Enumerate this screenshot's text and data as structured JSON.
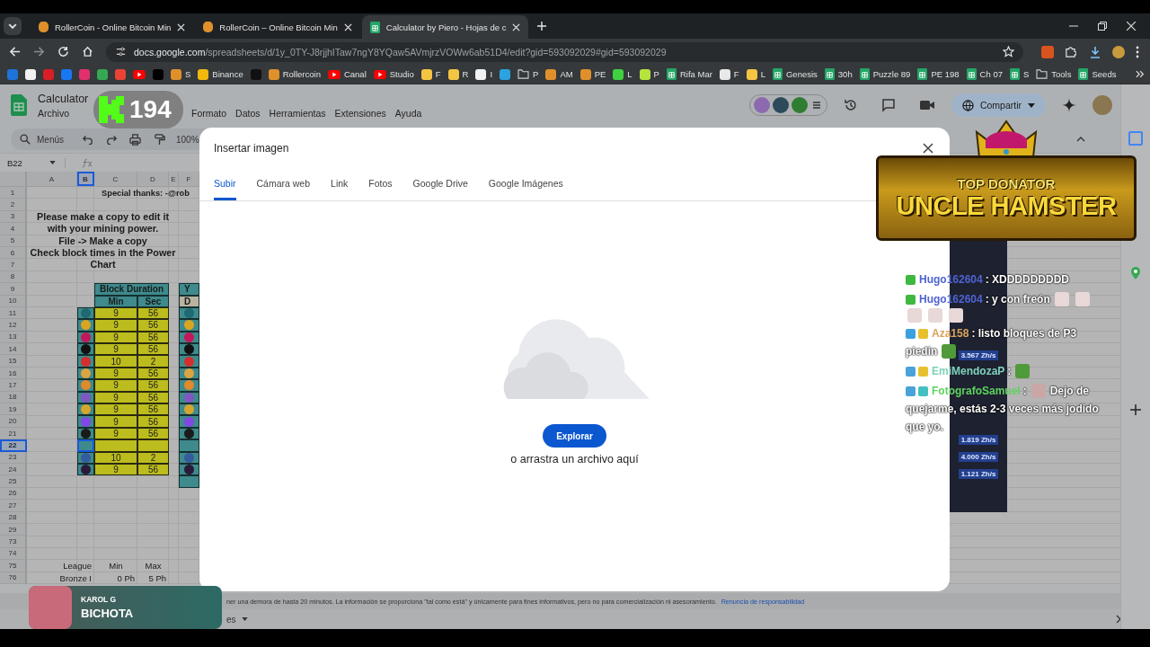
{
  "browser": {
    "tabs": [
      {
        "title": "RollerCoin - Online Bitcoin Min",
        "kind": "site",
        "selected": false
      },
      {
        "title": "RollerCoin – Online Bitcoin Min",
        "kind": "site",
        "selected": false
      },
      {
        "title": "Calculator by Piero - Hojas de c",
        "kind": "sheet",
        "selected": true
      }
    ],
    "url_host": "docs.google.com",
    "url_path": "/spreadsheets/d/1y_0TY-J8rjjhITaw7ngY8YQaw5AVmjrzVOWw6ab51D4/edit?gid=593092029#gid=593092029",
    "bookmarks": [
      {
        "kind": "site",
        "color": "#1e73d8"
      },
      {
        "kind": "site",
        "color": "#f2f2f2"
      },
      {
        "kind": "site",
        "color": "#d81f26"
      },
      {
        "kind": "site",
        "color": "#1877f2"
      },
      {
        "kind": "site",
        "color": "#e1306c"
      },
      {
        "kind": "site",
        "color": "#34a853"
      },
      {
        "kind": "site",
        "color": "#ea4335"
      },
      {
        "kind": "video"
      },
      {
        "kind": "site",
        "color": "#000000"
      },
      {
        "kind": "site",
        "color": "#e0902b",
        "label": "S"
      },
      {
        "kind": "site",
        "color": "#f0b90b",
        "label": "Binance"
      },
      {
        "kind": "site",
        "color": "#111111"
      },
      {
        "kind": "site",
        "color": "#e0902b",
        "label": "Rollercoin"
      },
      {
        "kind": "video",
        "label": "Canal"
      },
      {
        "kind": "video",
        "label": "Studio"
      },
      {
        "kind": "site",
        "color": "#f4c542",
        "label": "F"
      },
      {
        "kind": "site",
        "color": "#f4c542",
        "label": "R"
      },
      {
        "kind": "site",
        "color": "#f2f2f2",
        "label": "I"
      },
      {
        "kind": "site",
        "color": "#2aa3e0"
      },
      {
        "kind": "folder",
        "label": "P"
      },
      {
        "kind": "site",
        "color": "#e0902b",
        "label": "AM"
      },
      {
        "kind": "site",
        "color": "#e0902b",
        "label": "PE"
      },
      {
        "kind": "site",
        "color": "#3fd13f",
        "label": "L"
      },
      {
        "kind": "site",
        "color": "#b7e33d",
        "label": "P"
      },
      {
        "kind": "sheet",
        "label": "Rifa Mar"
      },
      {
        "kind": "site",
        "color": "#e8e8e8",
        "label": "F"
      },
      {
        "kind": "site",
        "color": "#f4c542",
        "label": "L"
      },
      {
        "kind": "sheet",
        "label": "Genesis"
      },
      {
        "kind": "sheet",
        "label": "30h"
      },
      {
        "kind": "sheet",
        "label": "Puzzle 89"
      },
      {
        "kind": "sheet",
        "label": "PE 198"
      },
      {
        "kind": "sheet",
        "label": "Ch 07"
      },
      {
        "kind": "sheet",
        "label": "S"
      },
      {
        "kind": "folder",
        "label": "Tools"
      },
      {
        "kind": "sheet",
        "label": "Seeds"
      }
    ]
  },
  "sheet": {
    "title": "Calculator",
    "menus": [
      "Archivo",
      "Formato",
      "Datos",
      "Herramientas",
      "Extensiones",
      "Ayuda"
    ],
    "search": {
      "placeholder": "Menús"
    },
    "zoom": "100%",
    "share": "Compartir",
    "name_box": "B22",
    "columns": [
      {
        "label": "A",
        "selected": false
      },
      {
        "label": "B",
        "selected": true
      },
      {
        "label": "C",
        "selected": false
      },
      {
        "label": "D",
        "selected": false
      },
      {
        "label": "E",
        "selected": false
      },
      {
        "label": "F",
        "selected": false
      }
    ],
    "rows": [
      {
        "label": "1",
        "selected": false
      },
      {
        "label": "2",
        "selected": false
      },
      {
        "label": "3",
        "selected": false
      },
      {
        "label": "4",
        "selected": false
      },
      {
        "label": "5",
        "selected": false
      },
      {
        "label": "6",
        "selected": false
      },
      {
        "label": "7",
        "selected": false
      },
      {
        "label": "8",
        "selected": false
      },
      {
        "label": "9",
        "selected": false
      },
      {
        "label": "10",
        "selected": false
      },
      {
        "label": "11",
        "selected": false
      },
      {
        "label": "12",
        "selected": false
      },
      {
        "label": "13",
        "selected": false
      },
      {
        "label": "14",
        "selected": false
      },
      {
        "label": "15",
        "selected": false
      },
      {
        "label": "16",
        "selected": false
      },
      {
        "label": "17",
        "selected": false
      },
      {
        "label": "18",
        "selected": false
      },
      {
        "label": "19",
        "selected": false
      },
      {
        "label": "20",
        "selected": false
      },
      {
        "label": "21",
        "selected": false
      },
      {
        "label": "22",
        "selected": true
      },
      {
        "label": "23",
        "selected": false
      },
      {
        "label": "24",
        "selected": false
      },
      {
        "label": "25",
        "selected": false
      },
      {
        "label": "26",
        "selected": false
      },
      {
        "label": "27",
        "selected": false
      },
      {
        "label": "28",
        "selected": false
      },
      {
        "label": "29",
        "selected": false
      },
      {
        "label": "73",
        "selected": false
      },
      {
        "label": "74",
        "selected": false
      },
      {
        "label": "75",
        "selected": false
      },
      {
        "label": "76",
        "selected": false
      }
    ],
    "note": "Special thanks:  -@rob",
    "instructions": [
      "Please make a copy to edit it",
      "with your mining power.",
      "File -> Make a copy",
      "Check block times in the Power",
      "Chart"
    ],
    "block_table": {
      "title": "Block Duration",
      "headers": [
        "Min",
        "Sec"
      ],
      "rows": [
        {
          "color": "#1f6a72",
          "min": "9",
          "sec": "56",
          "selected": false
        },
        {
          "color": "#d9a520",
          "min": "9",
          "sec": "56",
          "selected": false
        },
        {
          "color": "#c2185b",
          "min": "9",
          "sec": "56",
          "selected": false
        },
        {
          "color": "#111111",
          "min": "9",
          "sec": "56",
          "selected": false
        },
        {
          "color": "#d32f2f",
          "min": "10",
          "sec": "2",
          "selected": false
        },
        {
          "color": "#d9a441",
          "min": "9",
          "sec": "56",
          "selected": false
        },
        {
          "color": "#e08a2b",
          "min": "9",
          "sec": "56",
          "selected": false
        },
        {
          "color": "#7e57c2",
          "min": "9",
          "sec": "56",
          "selected": false
        },
        {
          "color": "#d4a72c",
          "min": "9",
          "sec": "56",
          "selected": false
        },
        {
          "color": "#8247e5",
          "min": "9",
          "sec": "56",
          "selected": false
        },
        {
          "color": "#1a1a1a",
          "min": "9",
          "sec": "56",
          "selected": false
        },
        {
          "selected": true
        },
        {
          "color": "#345d9d",
          "min": "10",
          "sec": "2",
          "selected": false
        },
        {
          "color": "#2a1a3a",
          "min": "9",
          "sec": "56",
          "selected": false
        }
      ]
    },
    "side_table": {
      "title": "Y",
      "header": "D"
    },
    "league": {
      "headers": [
        "League",
        "Min",
        "Max"
      ],
      "values": [
        "Bronze I",
        "0 Ph",
        "5 Ph"
      ]
    },
    "disclaimer": "ner una demora de hasta 20 minutos. La información se proporciona \"tal como está\" y únicamente para fines informativos, pero no para comercialización ni asesoramiento.",
    "disclaimer_link": "Renuncia de responsabilidad",
    "sheet_tab": "es"
  },
  "dialog": {
    "title": "Insertar imagen",
    "tabs": [
      {
        "label": "Subir",
        "selected": true
      },
      {
        "label": "Cámara web",
        "selected": false
      },
      {
        "label": "Link",
        "selected": false
      },
      {
        "label": "Fotos",
        "selected": false
      },
      {
        "label": "Google Drive",
        "selected": false
      },
      {
        "label": "Google Imágenes",
        "selected": false
      }
    ],
    "button": "Explorar",
    "hint": "o arrastra un archivo aquí"
  },
  "overlays": {
    "counter": "194",
    "banner": {
      "kicker": "TOP DONATOR",
      "name": "UNCLE HAMSTER"
    },
    "now_playing": {
      "artist": "KAROL G",
      "title": "BICHOTA"
    },
    "hashrates": [
      "3.567 Zh/s",
      "1.819 Zh/s",
      "4.000 Zh/s",
      "1.121 Zh/s"
    ],
    "chat": [
      {
        "parts": [
          {
            "kind": "badge",
            "color": "#3fb83f"
          },
          {
            "kind": "user",
            "text": "Hugo162604",
            "color": "#4f63d2"
          },
          {
            "kind": "text",
            "text": ": XDDDDDDDDD"
          }
        ]
      },
      {
        "parts": [
          {
            "kind": "badge",
            "color": "#3fb83f"
          },
          {
            "kind": "user",
            "text": "Hugo162604",
            "color": "#4f63d2"
          },
          {
            "kind": "text",
            "text": ": y con freón"
          },
          {
            "kind": "emote",
            "color": "#e8d8d8"
          },
          {
            "kind": "emote",
            "color": "#e8d8d8"
          },
          {
            "kind": "emote",
            "color": "#e8d8d8"
          },
          {
            "kind": "emote",
            "color": "#e8d8d8"
          },
          {
            "kind": "emote",
            "color": "#e8d8d8"
          }
        ]
      },
      {
        "parts": [
          {
            "kind": "badge",
            "color": "#3aa0e0"
          },
          {
            "kind": "badge",
            "color": "#e6c12e"
          },
          {
            "kind": "user",
            "text": "Aza158",
            "color": "#d9a25a"
          },
          {
            "kind": "text",
            "text": ": listo bloques de P3"
          },
          {
            "kind": "text",
            "text": "piedin"
          },
          {
            "kind": "emote",
            "color": "#4f9a3a"
          }
        ]
      },
      {
        "parts": [
          {
            "kind": "badge",
            "color": "#4aa3d8"
          },
          {
            "kind": "badge",
            "color": "#e6c12e"
          },
          {
            "kind": "user",
            "text": "EmiMendozaP",
            "color": "#7fd1b9"
          },
          {
            "kind": "text",
            "text": ":"
          },
          {
            "kind": "emote",
            "color": "#4f9a3a"
          }
        ]
      },
      {
        "parts": [
          {
            "kind": "badge",
            "color": "#4aa3d8"
          },
          {
            "kind": "badge",
            "color": "#45c0c0"
          },
          {
            "kind": "user",
            "text": "FotografoSamuel",
            "color": "#5fd35f"
          },
          {
            "kind": "text",
            "text": ":"
          },
          {
            "kind": "emote",
            "color": "#c9a7a7"
          },
          {
            "kind": "text",
            "text": "Dejo de"
          },
          {
            "kind": "text",
            "text": "quejarme, estás 2-3 veces más jodido"
          },
          {
            "kind": "text",
            "text": "que yo."
          }
        ]
      }
    ]
  }
}
